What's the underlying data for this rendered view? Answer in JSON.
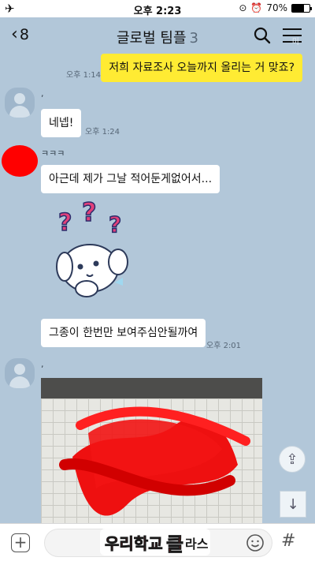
{
  "status_bar": {
    "time": "오후 2:23",
    "battery": "70%",
    "battery_level": 0.7
  },
  "header": {
    "back_count": "8",
    "title": "글로벌 팀플",
    "member_count": "3",
    "corner_badge": "미"
  },
  "messages": {
    "m1": {
      "text": "저희 자료조사 오늘까지 올리는 거 맞죠?",
      "time": "오후 1:14"
    },
    "m2_name": ",",
    "m2": {
      "text": "네넵!",
      "time": "오후 1:24"
    },
    "m3_name": "ㅋㅋㅋ",
    "m3": {
      "text": "아근데 제가 그날 적어둔게없어서..."
    },
    "m4": {
      "text": "그종이 한번만 보여주심안될까여",
      "time": "오후 2:01"
    },
    "m5_name": ","
  },
  "icons": {
    "back": "chevron-left-icon",
    "search": "search-icon",
    "menu": "menu-icon",
    "share": "share-icon",
    "scroll_down": "arrow-down-icon",
    "plus": "plus-icon",
    "emoji": "emoji-icon",
    "hash": "hash-icon"
  },
  "colors": {
    "chat_bg": "#b2c7d9",
    "my_bubble": "#ffeb33",
    "other_bubble": "#ffffff",
    "redaction": "#ff0000"
  },
  "watermark_text": "우리학교 클라스"
}
